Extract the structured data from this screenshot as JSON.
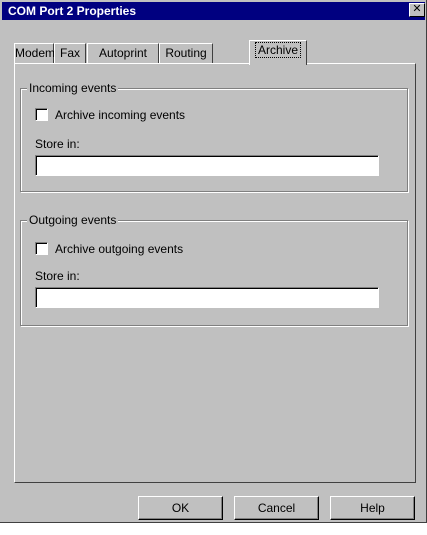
{
  "window": {
    "title": "COM Port 2 Properties",
    "close_glyph": "✕"
  },
  "tabs": [
    {
      "label": "Modem"
    },
    {
      "label": "Fax"
    },
    {
      "label": "Autoprint"
    },
    {
      "label": "Routing"
    },
    {
      "label": "Archive",
      "active": true
    }
  ],
  "incoming": {
    "legend": "Incoming events",
    "checkbox_label": "Archive incoming events",
    "checked": false,
    "store_label": "Store in:",
    "store_value": ""
  },
  "outgoing": {
    "legend": "Outgoing events",
    "checkbox_label": "Archive outgoing events",
    "checked": false,
    "store_label": "Store in:",
    "store_value": ""
  },
  "buttons": {
    "ok": "OK",
    "cancel": "Cancel",
    "help": "Help"
  },
  "colors": {
    "titlebar": "#000080",
    "face": "#c0c0c0"
  }
}
